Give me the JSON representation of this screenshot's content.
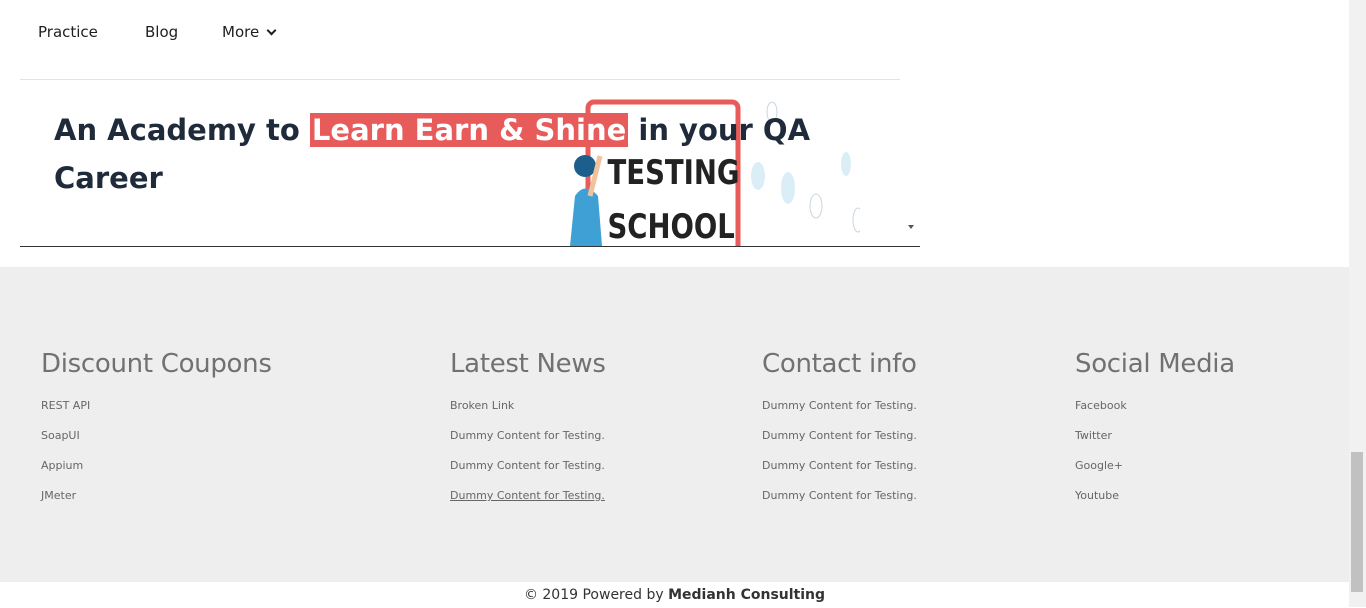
{
  "nav": {
    "items": [
      {
        "label": "Practice"
      },
      {
        "label": "Blog"
      },
      {
        "label": "More"
      }
    ]
  },
  "hero": {
    "title_before": "An Academy to ",
    "title_highlight": "Learn Earn & Shine",
    "title_after": "  in your QA Career",
    "image_text_1": "TESTING",
    "image_text_2": "SCHOOL"
  },
  "footer": {
    "columns": [
      {
        "title": "Discount Coupons",
        "links": [
          "REST API",
          "SoapUI",
          "Appium",
          "JMeter"
        ]
      },
      {
        "title": "Latest News",
        "links": [
          "Broken Link",
          "Dummy Content for Testing.",
          "Dummy Content for Testing.",
          "Dummy Content for Testing."
        ]
      },
      {
        "title": "Contact info",
        "links": [
          "Dummy Content for Testing.",
          "Dummy Content for Testing.",
          "Dummy Content for Testing.",
          "Dummy Content for Testing."
        ]
      },
      {
        "title": "Social Media",
        "links": [
          "Facebook",
          "Twitter",
          "Google+",
          "Youtube"
        ]
      }
    ],
    "copyright_prefix": "© 2019 Powered by ",
    "copyright_brand": "Medianh Consulting"
  },
  "colors": {
    "highlight": "#e85b5b",
    "footer_bg": "#eeeeee",
    "title_text": "#1f2a3a"
  },
  "icons": [
    "chevron-down-icon",
    "scroll-down-arrow-icon"
  ]
}
